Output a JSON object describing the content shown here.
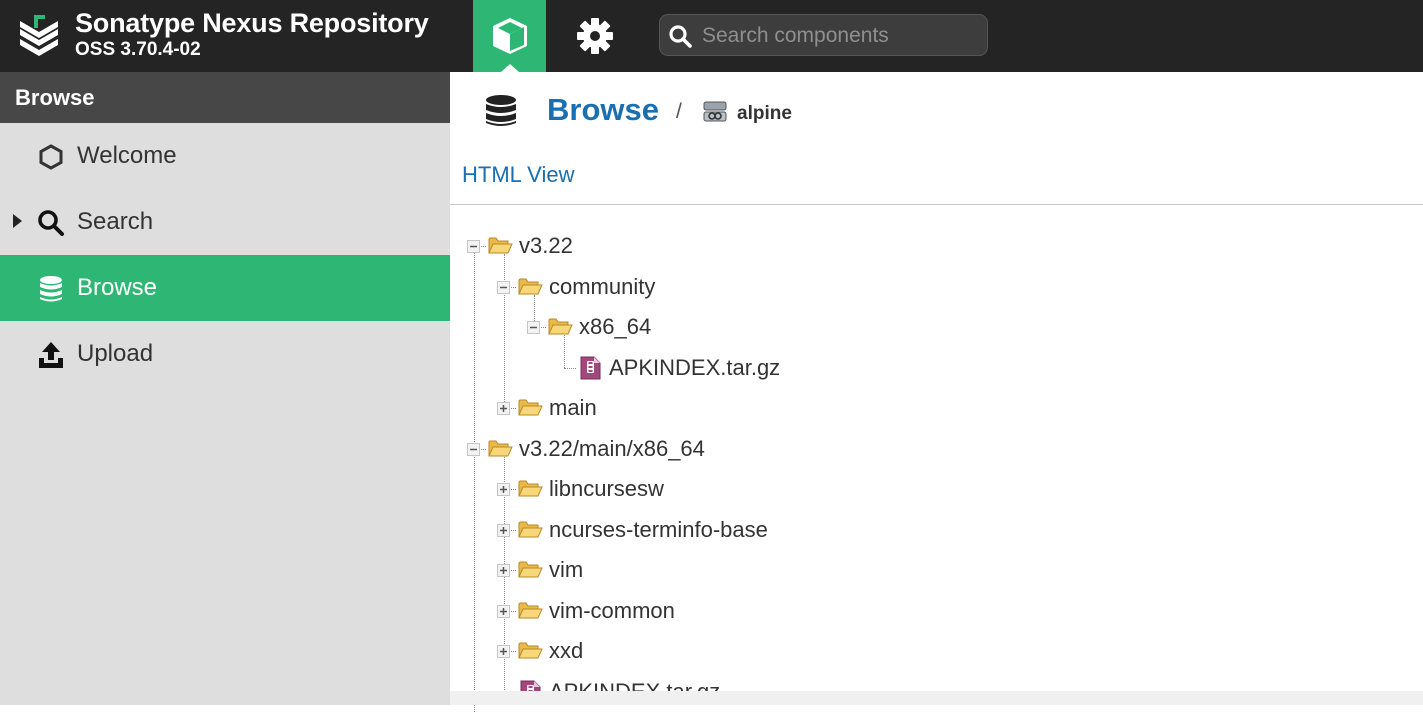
{
  "header": {
    "product_name": "Sonatype Nexus Repository",
    "product_version": "OSS 3.70.4-02",
    "search_placeholder": "Search components"
  },
  "sidebar": {
    "title": "Browse",
    "items": [
      {
        "label": "Welcome",
        "icon": "hexagon-icon",
        "active": false
      },
      {
        "label": "Search",
        "icon": "magnifier-icon",
        "active": false,
        "expandable": true
      },
      {
        "label": "Browse",
        "icon": "database-icon",
        "active": true
      },
      {
        "label": "Upload",
        "icon": "upload-icon",
        "active": false
      }
    ]
  },
  "main": {
    "title": "Browse",
    "separator": "/",
    "repository": "alpine",
    "html_view_link": "HTML View",
    "tree": [
      {
        "label": "v3.22",
        "type": "folder",
        "expanded": true,
        "depth": 0
      },
      {
        "label": "community",
        "type": "folder",
        "expanded": true,
        "depth": 1
      },
      {
        "label": "x86_64",
        "type": "folder",
        "expanded": true,
        "depth": 2
      },
      {
        "label": "APKINDEX.tar.gz",
        "type": "file",
        "depth": 3
      },
      {
        "label": "main",
        "type": "folder",
        "expanded": false,
        "depth": 1
      },
      {
        "label": "v3.22/main/x86_64",
        "type": "folder",
        "expanded": true,
        "depth": 0
      },
      {
        "label": "libncursesw",
        "type": "folder",
        "expanded": false,
        "depth": 1
      },
      {
        "label": "ncurses-terminfo-base",
        "type": "folder",
        "expanded": false,
        "depth": 1
      },
      {
        "label": "vim",
        "type": "folder",
        "expanded": false,
        "depth": 1
      },
      {
        "label": "vim-common",
        "type": "folder",
        "expanded": false,
        "depth": 1
      },
      {
        "label": "xxd",
        "type": "folder",
        "expanded": false,
        "depth": 1
      },
      {
        "label": "APKINDEX.tar.gz",
        "type": "file",
        "depth": 1
      }
    ]
  },
  "colors": {
    "topbar": "#242424",
    "accent_green": "#2eb774",
    "link_blue": "#1a6fb0",
    "sidebar_bg": "#dedede",
    "sidebar_header": "#474747"
  }
}
